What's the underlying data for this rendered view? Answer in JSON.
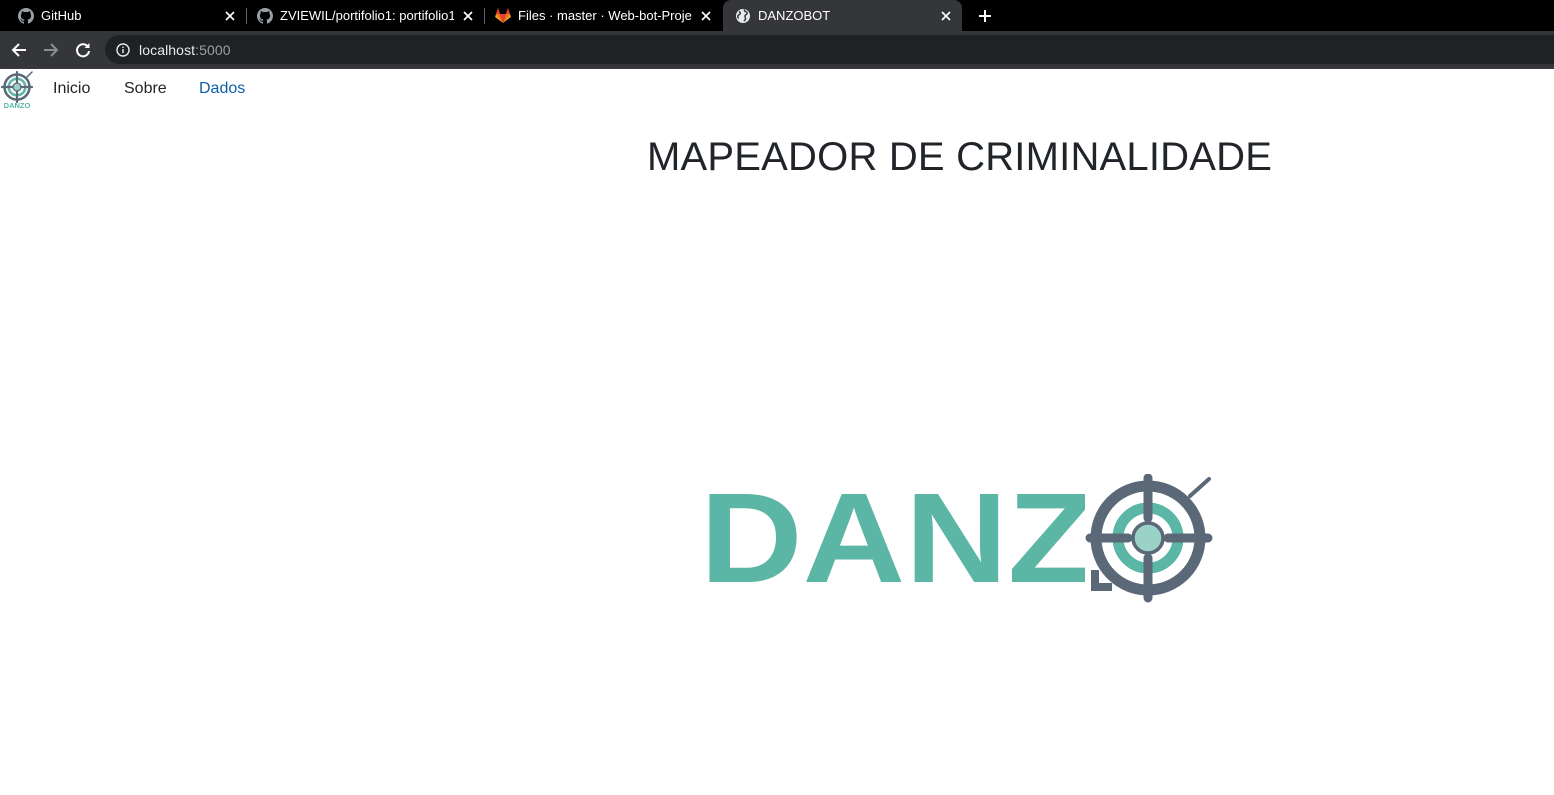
{
  "browser": {
    "tabs": [
      {
        "title": "GitHub",
        "icon": "github-icon"
      },
      {
        "title": "ZVIEWIL/portifolio1: portifolio1",
        "icon": "github-icon"
      },
      {
        "title": "Files · master · Web-bot-Project / ",
        "icon": "gitlab-icon"
      },
      {
        "title": "DANZOBOT",
        "icon": "globe-icon",
        "active": true
      }
    ],
    "address": {
      "host": "localhost",
      "port": ":5000"
    }
  },
  "navbar": {
    "logo_text": "DANZO",
    "links": [
      {
        "label": "Inicio"
      },
      {
        "label": "Sobre"
      },
      {
        "label": "Dados",
        "active": true
      }
    ]
  },
  "main": {
    "title": "MAPEADOR DE CRIMINALIDADE",
    "logo_text": "DANZO"
  },
  "colors": {
    "brand_teal": "#5cb6a5",
    "brand_slate": "#5a6877",
    "brand_mint": "#9bd2c8",
    "active_link": "#0d5fa8"
  }
}
